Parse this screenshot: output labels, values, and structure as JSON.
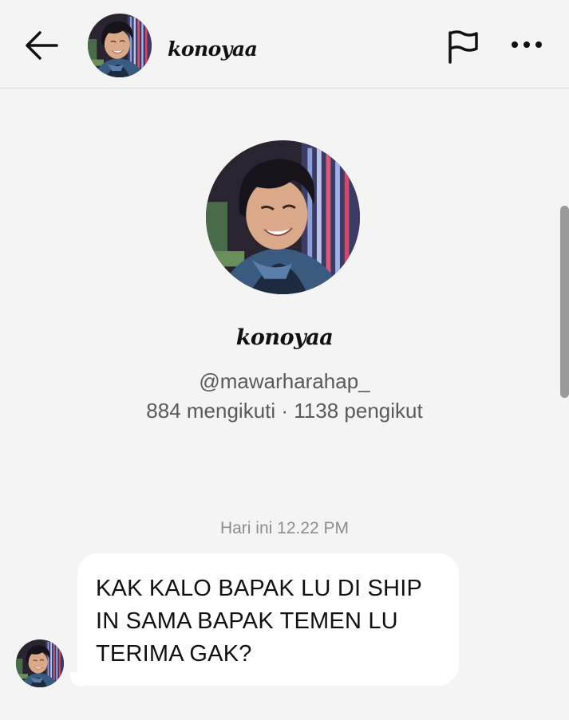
{
  "header": {
    "username": "konoyaa",
    "back_icon": "arrow-left-icon",
    "report_icon": "flag-icon",
    "more_icon": "more-horizontal-icon"
  },
  "profile": {
    "display_name": "konoyaa",
    "handle": "@mawarharahap_",
    "stats": "884 mengikuti · 1138 pengikut"
  },
  "conversation": {
    "timestamp": "Hari ini 12.22 PM",
    "messages": [
      {
        "sender": "konoyaa",
        "text": "KAK KALO BAPAK LU DI SHIP IN SAMA BAPAK TEMEN LU TERIMA GAK?"
      }
    ]
  },
  "colors": {
    "background": "#f4f4f4",
    "bubble": "#ffffff",
    "secondary_text": "#5a5a5a",
    "timestamp_text": "#8d8d8d"
  }
}
